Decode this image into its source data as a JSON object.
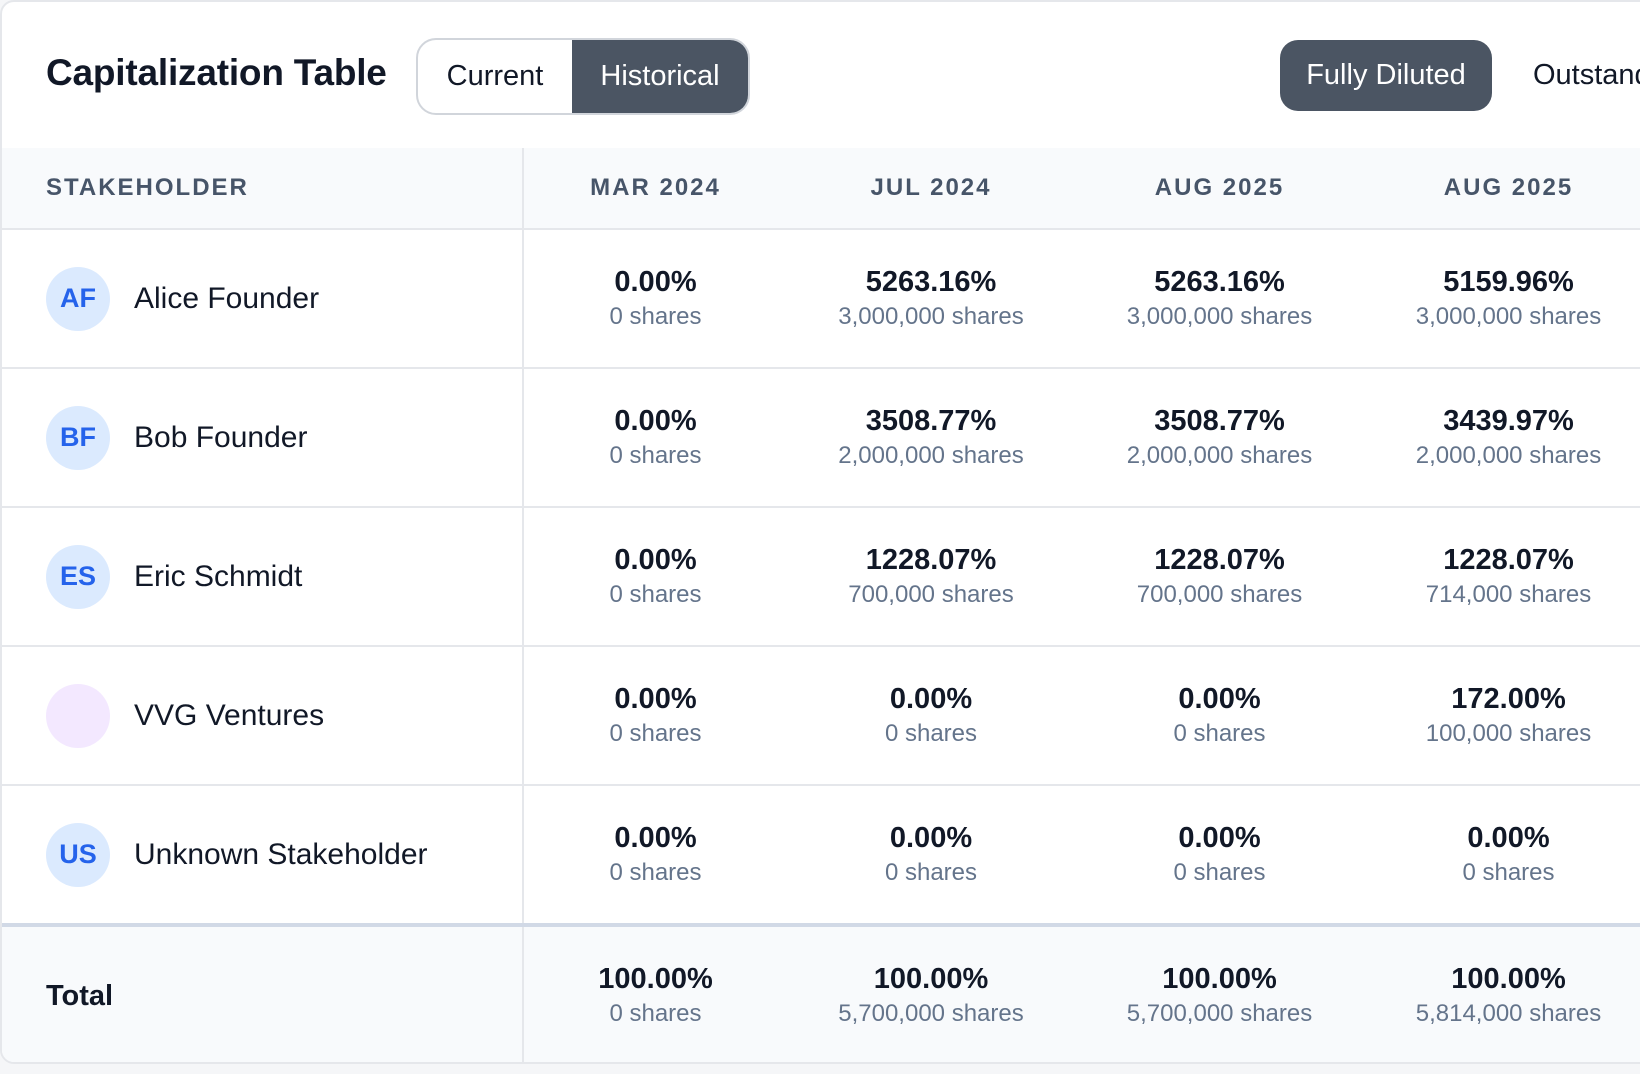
{
  "header": {
    "title": "Capitalization Table",
    "toggle": {
      "current_label": "Current",
      "historical_label": "Historical",
      "selected": "Historical"
    },
    "view": {
      "fully_diluted_label": "Fully Diluted",
      "outstanding_label": "Outstanding",
      "selected": "Fully Diluted"
    }
  },
  "table": {
    "columns": [
      "STAKEHOLDER",
      "MAR 2024",
      "JUL 2024",
      "AUG 2025",
      "AUG 2025"
    ],
    "rows": [
      {
        "initials": "AF",
        "name": "Alice Founder",
        "cells": [
          {
            "pct": "0.00%",
            "shares": "0 shares"
          },
          {
            "pct": "5263.16%",
            "shares": "3,000,000 shares"
          },
          {
            "pct": "5263.16%",
            "shares": "3,000,000 shares"
          },
          {
            "pct": "5159.96%",
            "shares": "3,000,000 shares"
          }
        ]
      },
      {
        "initials": "BF",
        "name": "Bob Founder",
        "cells": [
          {
            "pct": "0.00%",
            "shares": "0 shares"
          },
          {
            "pct": "3508.77%",
            "shares": "2,000,000 shares"
          },
          {
            "pct": "3508.77%",
            "shares": "2,000,000 shares"
          },
          {
            "pct": "3439.97%",
            "shares": "2,000,000 shares"
          }
        ]
      },
      {
        "initials": "ES",
        "name": "Eric Schmidt",
        "cells": [
          {
            "pct": "0.00%",
            "shares": "0 shares"
          },
          {
            "pct": "1228.07%",
            "shares": "700,000 shares"
          },
          {
            "pct": "1228.07%",
            "shares": "700,000 shares"
          },
          {
            "pct": "1228.07%",
            "shares": "714,000 shares"
          }
        ]
      },
      {
        "initials": "",
        "name": "VVG Ventures",
        "cells": [
          {
            "pct": "0.00%",
            "shares": "0 shares"
          },
          {
            "pct": "0.00%",
            "shares": "0 shares"
          },
          {
            "pct": "0.00%",
            "shares": "0 shares"
          },
          {
            "pct": "172.00%",
            "shares": "100,000 shares"
          }
        ]
      },
      {
        "initials": "US",
        "name": "Unknown Stakeholder",
        "cells": [
          {
            "pct": "0.00%",
            "shares": "0 shares"
          },
          {
            "pct": "0.00%",
            "shares": "0 shares"
          },
          {
            "pct": "0.00%",
            "shares": "0 shares"
          },
          {
            "pct": "0.00%",
            "shares": "0 shares"
          }
        ]
      }
    ],
    "total": {
      "label": "Total",
      "cells": [
        {
          "pct": "100.00%",
          "shares": "0 shares"
        },
        {
          "pct": "100.00%",
          "shares": "5,700,000 shares"
        },
        {
          "pct": "100.00%",
          "shares": "5,700,000 shares"
        },
        {
          "pct": "100.00%",
          "shares": "5,814,000 shares"
        }
      ]
    }
  },
  "colors": {
    "accent_dark": "#4b5563",
    "avatar_bg": "#dbeafe",
    "avatar_text": "#2563eb",
    "avatar_alt_bg": "#f3e8ff"
  }
}
